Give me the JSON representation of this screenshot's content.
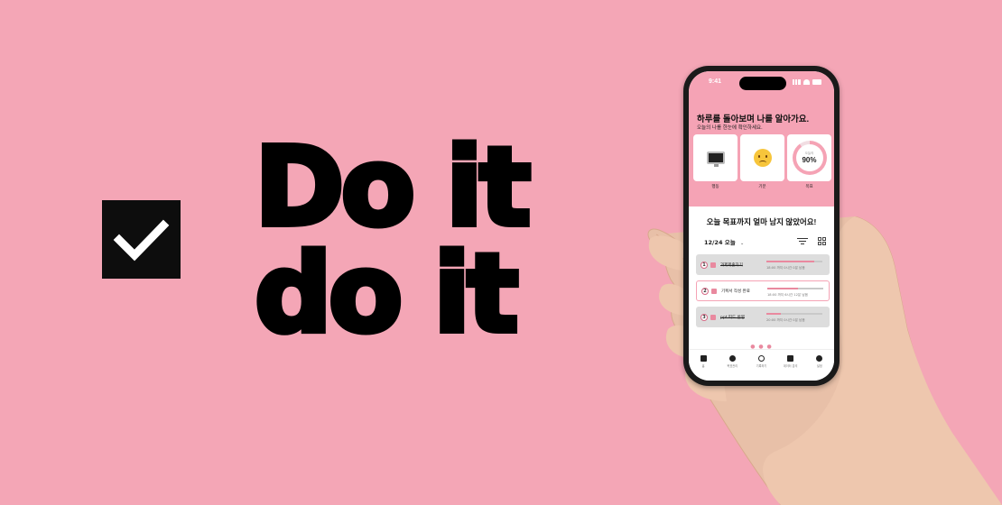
{
  "colors": {
    "background": "#f4a6b6",
    "accent": "#f5a3b5",
    "ink": "#000000"
  },
  "headline": {
    "line1": "Do it",
    "line2": "do it"
  },
  "phone": {
    "status_time": "9:41",
    "header_title": "하루를 돌아보며 나를 알아가요.",
    "header_subtitle": "오늘의 나를 한눈에 확인하세요.",
    "cards": [
      {
        "label": "행동",
        "icon": "monitor-icon"
      },
      {
        "label": "기분",
        "icon": "sad-face-icon"
      },
      {
        "label": "목표",
        "caption": "오늘의",
        "value": "90%",
        "progress": 0.9
      }
    ],
    "question_title": "오늘 목표까지 얼마 남지 않았어요!",
    "date_label": "12/24 오늘",
    "tasks": [
      {
        "num": "1",
        "name": "과제제출하기",
        "time": "18:00 까지 0시간 0분 남음",
        "progress": 0.85,
        "state": "done"
      },
      {
        "num": "2",
        "name": "기획서 작성 완료",
        "time": "18:00 까지 6시간 12분 남음",
        "progress": 0.55,
        "state": "active"
      },
      {
        "num": "3",
        "name": "ppt 피드 반영",
        "time": "20:00 까지 0시간 0분 남음",
        "progress": 0.25,
        "state": "done"
      }
    ],
    "page_dots": "● ● ●",
    "tabs": [
      {
        "label": "홈",
        "icon": "home-icon"
      },
      {
        "label": "목표관리",
        "icon": "target-icon"
      },
      {
        "label": "기록하기",
        "icon": "plus-circle-icon"
      },
      {
        "label": "데이터 분석",
        "icon": "bar-chart-icon"
      },
      {
        "label": "설정",
        "icon": "settings-icon"
      }
    ]
  }
}
